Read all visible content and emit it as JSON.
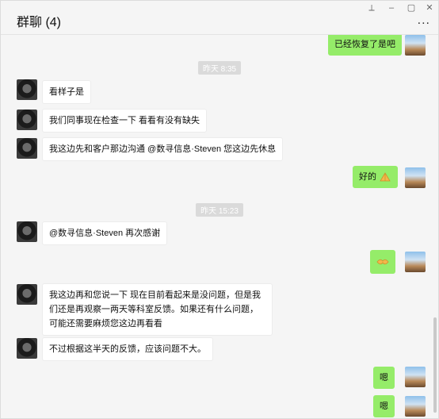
{
  "window": {
    "title": "群聊 (4)",
    "more_glyph": "...",
    "pin_glyph": "⟂",
    "min_glyph": "–",
    "max_glyph": "▢",
    "close_glyph": "✕"
  },
  "chat": {
    "messages": [
      {
        "side": "right",
        "text": "已经恢复了是吧"
      },
      {
        "time": "昨天 8:35"
      },
      {
        "side": "left",
        "text": "看样子是"
      },
      {
        "side": "left",
        "text": "我们同事现在检查一下 看看有没有缺失"
      },
      {
        "side": "left",
        "text": "我这边先和客户那边沟通 @数寻信息·Steven 您这边先休息"
      },
      {
        "side": "right",
        "text": "好的",
        "emoji": "pray-hands"
      },
      {
        "time": "昨天 15:23"
      },
      {
        "side": "left",
        "text": "@数寻信息·Steven 再次感谢"
      },
      {
        "side": "right",
        "emoji": "handshake"
      },
      {
        "side": "left",
        "text": "我这边再和您说一下 现在目前看起来是没问题，但是我们还是再观察一两天等科室反馈。如果还有什么问题，可能还需要麻烦您这边再看看"
      },
      {
        "side": "left",
        "text": "不过根据这半天的反馈，应该问题不大。"
      },
      {
        "side": "right",
        "text": "嗯"
      },
      {
        "side": "right",
        "text": "嗯"
      }
    ]
  },
  "icons": {
    "accent": "#95ec69"
  }
}
